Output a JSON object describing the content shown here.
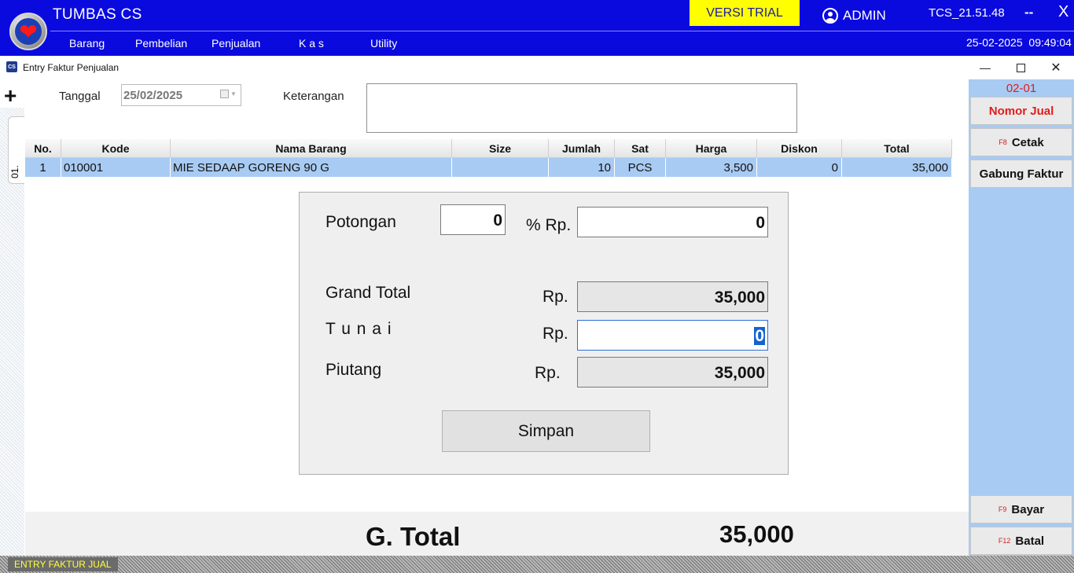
{
  "app": {
    "title": "TUMBAS CS",
    "trial_badge": "VERSI TRIAL",
    "user": "ADMIN",
    "version": "TCS_21.51.48",
    "minimize_label": "--",
    "close_label": "X",
    "date": "25-02-2025",
    "time": "09:49:04",
    "brand_color": "#0a0adf",
    "trial_color": "#ffff00"
  },
  "menu": {
    "items": [
      "Barang",
      "Pembelian",
      "Penjualan",
      "K a s",
      "Utility"
    ]
  },
  "form": {
    "icon_text": "CS",
    "title": "Entry Faktur Penjualan",
    "tab_label": "01."
  },
  "header": {
    "add_label": "+",
    "tanggal_label": "Tanggal",
    "tanggal_value": "25/02/2025",
    "keterangan_label": "Keterangan",
    "keterangan_value": ""
  },
  "grid": {
    "columns": [
      "No.",
      "Kode",
      "Nama Barang",
      "Size",
      "Jumlah",
      "Sat",
      "Harga",
      "Diskon",
      "Total"
    ],
    "rows": [
      [
        "1",
        "010001",
        "MIE SEDAAP GORENG 90 G",
        "",
        "10",
        "PCS",
        "3,500",
        "0",
        "35,000"
      ]
    ],
    "selected_row_color": "#a8cbf3"
  },
  "payment": {
    "potongan_label": "Potongan",
    "potongan_percent": "0",
    "percent_rp_label": "% Rp.",
    "potongan_rp": "0",
    "grand_total_label": "Grand Total",
    "grand_total_rp_label": "Rp.",
    "grand_total_value": "35,000",
    "tunai_label": "T u n a i",
    "tunai_rp_label": "Rp.",
    "tunai_value": "0",
    "piutang_label": "Piutang",
    "piutang_rp_label": "Rp.",
    "piutang_value": "35,000",
    "simpan_label": "Simpan"
  },
  "totals": {
    "label": "G. Total",
    "value": "35,000"
  },
  "sidebar": {
    "nomor": "02-01",
    "nomor_jual_label": "Nomor Jual",
    "cetak_key": "F8",
    "cetak_label": "Cetak",
    "gabung_label": "Gabung Faktur",
    "bayar_key": "F9",
    "bayar_label": "Bayar",
    "batal_key": "F12",
    "batal_label": "Batal"
  },
  "status": {
    "label": "ENTRY FAKTUR JUAL"
  }
}
